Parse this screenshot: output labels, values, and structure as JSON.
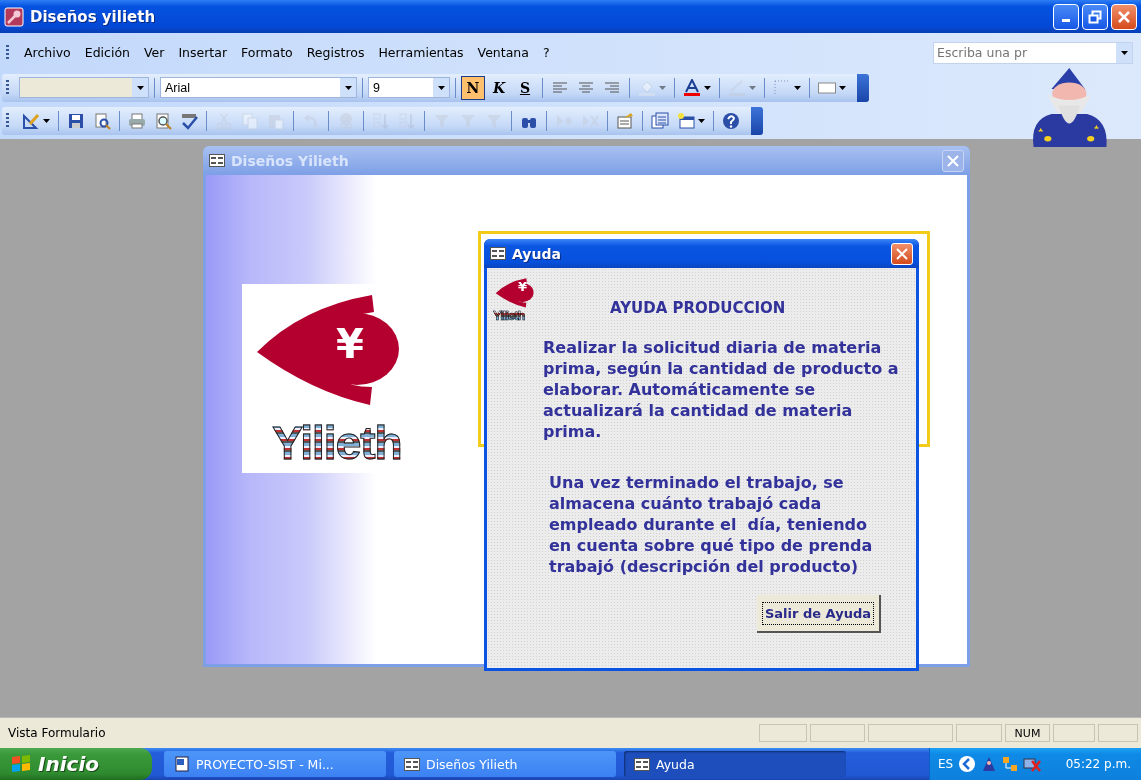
{
  "window": {
    "title": "Diseños yilieth"
  },
  "menu": [
    "Archivo",
    "Edición",
    "Ver",
    "Insertar",
    "Formato",
    "Registros",
    "Herramientas",
    "Ventana",
    "?"
  ],
  "ask_box": {
    "placeholder": "Escriba una pr"
  },
  "format_toolbar": {
    "font": "Arial",
    "size": "9",
    "style_buttons": [
      {
        "label": "N",
        "selected": true
      },
      {
        "label": "K",
        "selected": false
      },
      {
        "label": "S",
        "selected": false
      }
    ],
    "tools": [
      {
        "disabled": false
      },
      {
        "disabled": false
      },
      {
        "disabled": false
      },
      {
        "disabled": true
      },
      {
        "disabled": false
      },
      {
        "disabled": true
      },
      {
        "disabled": false
      },
      {
        "disabled": false
      }
    ]
  },
  "toolbar": [
    {
      "disabled": false
    },
    {
      "disabled": false
    },
    {
      "disabled": false
    },
    {
      "disabled": false
    },
    {
      "disabled": false
    },
    {
      "disabled": false
    },
    {
      "disabled": true
    },
    {
      "disabled": true
    },
    {
      "disabled": true
    },
    {
      "disabled": true
    },
    {
      "disabled": true
    },
    {
      "disabled": true
    },
    {
      "disabled": true
    },
    {
      "disabled": true
    },
    {
      "disabled": true
    },
    {
      "disabled": true
    },
    {
      "disabled": false
    },
    {
      "disabled": true
    },
    {
      "disabled": true
    },
    {
      "disabled": false
    },
    {
      "disabled": false
    },
    {
      "disabled": false
    },
    {
      "disabled": false
    }
  ],
  "form_window": {
    "title": "Diseños Yilieth",
    "active": false,
    "logo_symbol": "¥",
    "logo_text": "Yilieth"
  },
  "help_dialog": {
    "title": "Ayuda",
    "active": true,
    "logo_symbol": "¥",
    "logo_text": "Yilieth",
    "heading": "AYUDA PRODUCCION",
    "paragraphs": [
      "Realizar la solicitud diaria de materia prima, según la cantidad de producto a elaborar. Automáticamente se actualizará la cantidad de materia prima.",
      "Una vez terminado el trabajo, se almacena cuánto trabajó cada empleado durante el  día, teniendo en cuenta sobre qué tipo de prenda trabajó (descripción del producto)"
    ],
    "button": "Salir de Ayuda"
  },
  "status_bar": {
    "text": "Vista Formulario",
    "num": "NUM"
  },
  "taskbar": {
    "start": "Inicio",
    "tasks": [
      {
        "label": "PROYECTO-SIST - Mi...",
        "kind": "document",
        "selected": false
      },
      {
        "label": "Diseños Yilieth",
        "kind": "form",
        "selected": false
      },
      {
        "label": "Ayuda",
        "kind": "form",
        "selected": true
      }
    ],
    "language": "ES",
    "time": "05:22 p.m."
  }
}
